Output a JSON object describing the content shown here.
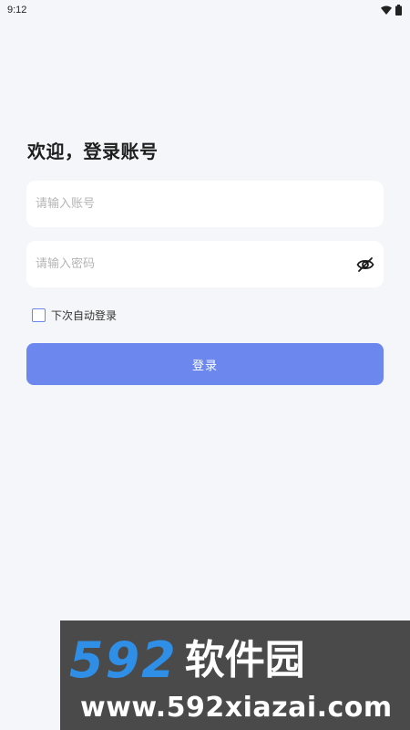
{
  "status_bar": {
    "time": "9:12",
    "icons": [
      "wifi-icon",
      "battery-icon"
    ]
  },
  "login": {
    "title": "欢迎，登录账号",
    "account_placeholder": "请输入账号",
    "password_placeholder": "请输入密码",
    "password_toggle_icon": "eye-off-icon",
    "remember_label": "下次自动登录",
    "remember_checked": false,
    "submit_label": "登录"
  },
  "watermark": {
    "number": "592",
    "name": "软件园",
    "url": "www.592xiazai.com"
  },
  "colors": {
    "background": "#f5f6f9",
    "accent": "#6c88ee",
    "checkbox_border": "#6b87ef",
    "watermark_bg": "#4a4a4a",
    "watermark_number": "#2f8fe6"
  }
}
